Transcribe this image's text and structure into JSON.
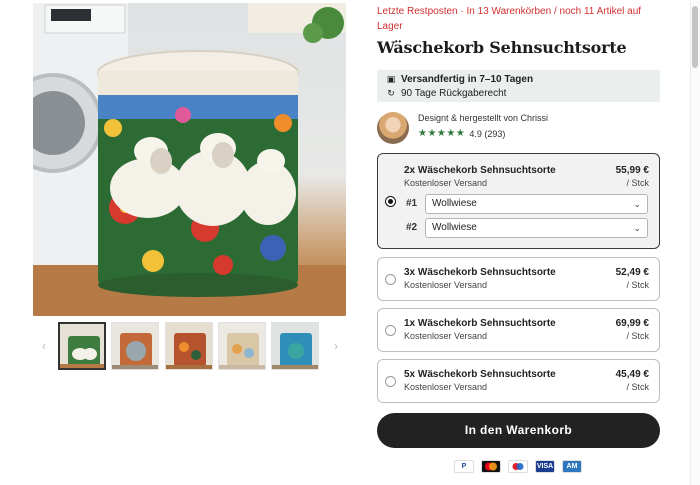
{
  "product": {
    "urgency": "Letzte Restposten · In 13 Warenkörben / noch 11 Artikel auf Lager",
    "title": "Wäschekorb Sehnsuchtsorte",
    "shipping": {
      "dispatch": "Versandfertig in 7–10 Tagen",
      "returns": "90 Tage Rückgaberecht",
      "dispatch_icon": "package-icon",
      "returns_icon": "return-arrow-icon"
    },
    "maker": {
      "text": "Designt & hergestellt von Chrissi",
      "stars": "★★★★★",
      "rating": "4.9 (293)"
    }
  },
  "gallery": {
    "main_image_alt": "Wäschekorb mit gestickten Schafen und Blumen",
    "thumbnails": [
      "Schafe",
      "Elefanten",
      "Blumen",
      "Pastell",
      "Meer"
    ],
    "prev_arrow": "‹",
    "next_arrow": "›"
  },
  "offers": [
    {
      "name": "2x Wäschekorb Sehnsuchtsorte",
      "shipping": "Kostenloser Versand",
      "price": "55,99 €",
      "unit": "/ Stck",
      "selected": true
    },
    {
      "name": "3x Wäschekorb Sehnsuchtsorte",
      "shipping": "Kostenloser Versand",
      "price": "52,49 €",
      "unit": "/ Stck",
      "selected": false
    },
    {
      "name": "1x Wäschekorb Sehnsuchtsorte",
      "shipping": "Kostenloser Versand",
      "price": "69,99 €",
      "unit": "/ Stck",
      "selected": false
    },
    {
      "name": "5x Wäschekorb Sehnsuchtsorte",
      "shipping": "Kostenloser Versand",
      "price": "45,49 €",
      "unit": "/ Stck",
      "selected": false
    }
  ],
  "variants": [
    {
      "label": "#1",
      "value": "Wollwiese"
    },
    {
      "label": "#2",
      "value": "Wollwiese"
    }
  ],
  "cart": {
    "label": "In den Warenkorb"
  },
  "payments": [
    {
      "name": "paypal-icon",
      "text": "P",
      "bg": "#ffffff",
      "fg": "#1a4c9c"
    },
    {
      "name": "mastercard-icon",
      "text": "",
      "bg": "#111111",
      "fg": "#ffffff"
    },
    {
      "name": "maestro-icon",
      "text": "",
      "bg": "#ffffff",
      "fg": "#e11d2a"
    },
    {
      "name": "visa-icon",
      "text": "VISA",
      "bg": "#1a3d8f",
      "fg": "#ffffff"
    },
    {
      "name": "amex-icon",
      "text": "AM",
      "bg": "#2e77bc",
      "fg": "#ffffff"
    }
  ],
  "colors": {
    "urgency": "#d23030",
    "stars": "#2f7a3b",
    "button": "#222222",
    "shipping_bg": "#eaeeec"
  }
}
